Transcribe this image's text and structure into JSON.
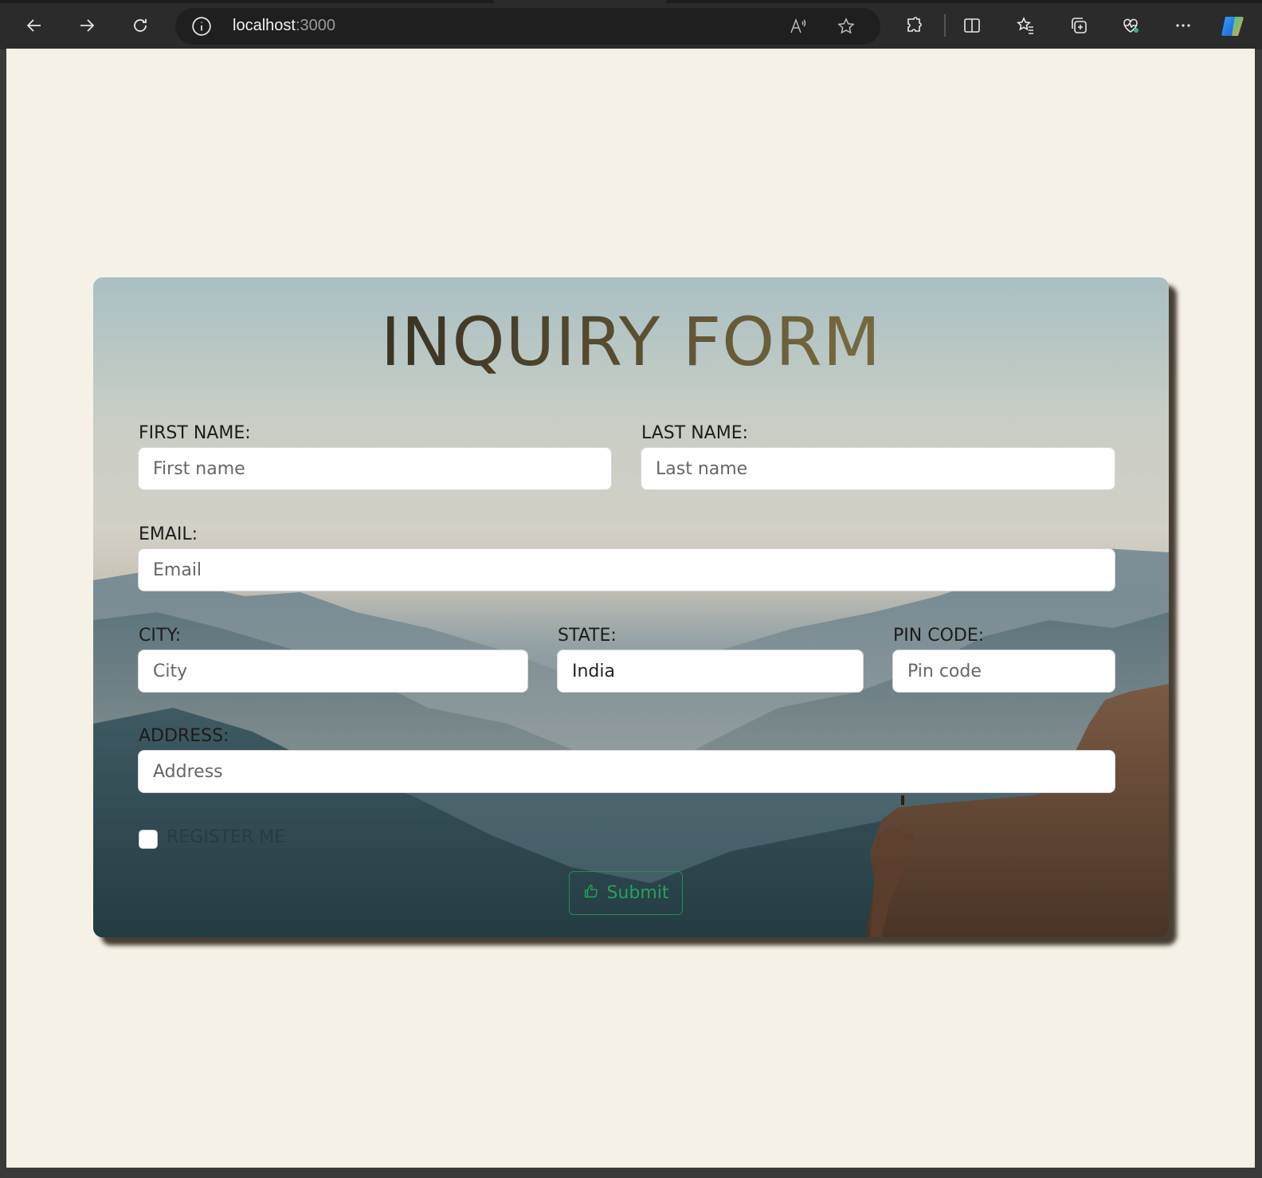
{
  "browser": {
    "url_host": "localhost",
    "url_port": ":3000"
  },
  "form": {
    "title": "INQUIRY FORM",
    "first_name": {
      "label": "FIRST NAME:",
      "placeholder": "First name"
    },
    "last_name": {
      "label": "LAST NAME:",
      "placeholder": "Last name"
    },
    "email": {
      "label": "EMAIL:",
      "placeholder": "Email"
    },
    "city": {
      "label": "CITY:",
      "placeholder": "City"
    },
    "state": {
      "label": "STATE:",
      "value": "India"
    },
    "pin_code": {
      "label": "PIN CODE:",
      "placeholder": "Pin code"
    },
    "address": {
      "label": "ADDRESS:",
      "placeholder": "Address"
    },
    "register": {
      "label": "REGISTER ME",
      "checked": false
    },
    "submit_label": "Submit"
  },
  "colors": {
    "page_background": "#f5f1e6",
    "submit_accent": "#22a35a",
    "title_gradient_start": "#3d3524",
    "title_gradient_end": "#75683f"
  }
}
